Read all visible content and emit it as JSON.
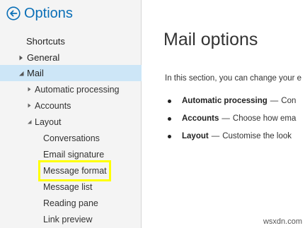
{
  "header": {
    "title": "Options",
    "back_icon": "back-arrow-circle-icon",
    "accent": "#0a6fb7"
  },
  "sidebar": {
    "shortcuts": "Shortcuts",
    "general": "General",
    "mail": "Mail",
    "automatic_processing": "Automatic processing",
    "accounts": "Accounts",
    "layout": "Layout",
    "conversations": "Conversations",
    "email_signature": "Email signature",
    "message_format": "Message format",
    "message_list": "Message list",
    "reading_pane": "Reading pane",
    "link_preview": "Link preview",
    "selected_color": "#cde6f7",
    "highlight_color": "#ffff00"
  },
  "main": {
    "title": "Mail options",
    "intro": "In this section, you can change your e",
    "bullets": [
      {
        "term": "Automatic processing",
        "desc": "Con"
      },
      {
        "term": "Accounts",
        "desc": "Choose how ema"
      },
      {
        "term": "Layout",
        "desc": "Customise the look"
      }
    ],
    "separator": "—"
  },
  "watermark": "wsxdn.com"
}
